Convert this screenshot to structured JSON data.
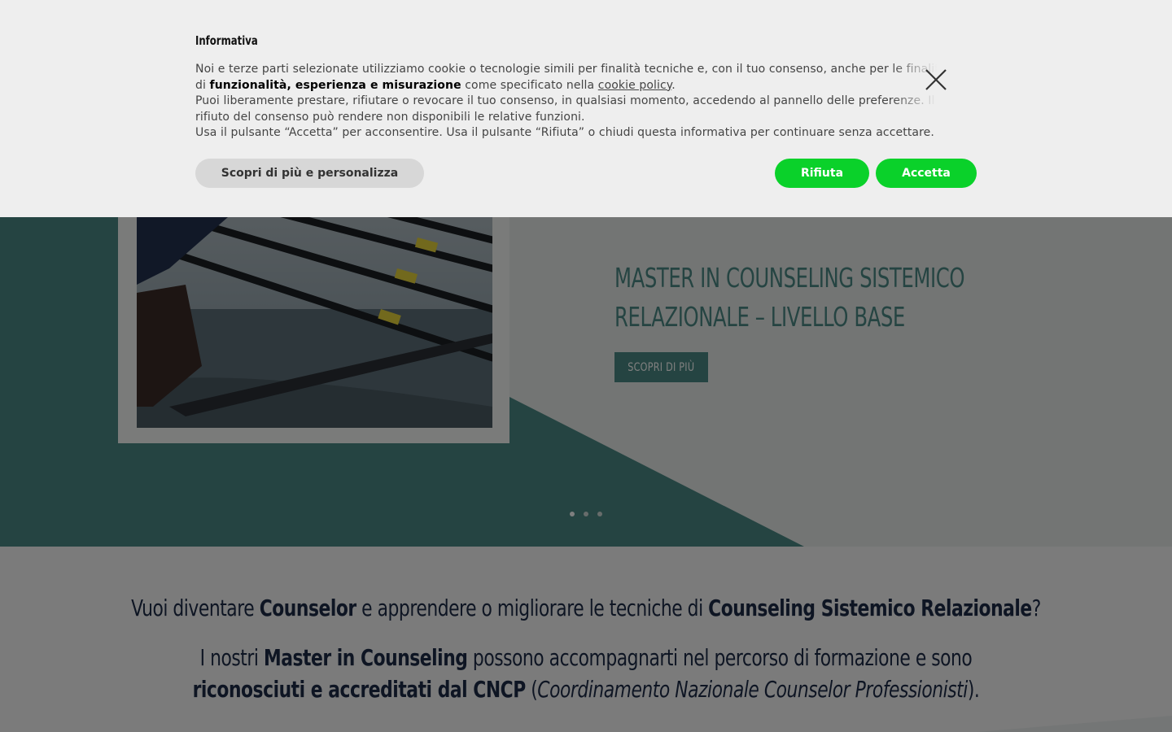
{
  "hero": {
    "title": "MASTER IN COUNSELING SISTEMICO RELAZIONALE – LIVELLO BASE",
    "cta_label": "SCOPRI DI PIÙ",
    "slides": [
      {
        "active": true
      },
      {
        "active": false
      },
      {
        "active": false
      }
    ]
  },
  "intro": {
    "q_pre": "Vuoi diventare ",
    "q_b1": "Counselor",
    "q_mid": " e apprendere o migliorare le tecniche di ",
    "q_b2": "Counseling Sistemico Relazionale",
    "q_end": "?",
    "p_pre": "I nostri ",
    "p_b1": "Master in Counseling",
    "p_mid": " possono accompagnarti nel percorso di formazione e sono ",
    "p_b2": "riconosciuti e accreditati dal CNCP",
    "p_open": " (",
    "p_italic": "Coordinamento Nazionale Counselor Professionisti",
    "p_close": ")."
  },
  "cookie_banner": {
    "title": "Informativa",
    "line1_pre": "Noi e terze parti selezionate utilizziamo cookie o tecnologie simili per finalità tecniche e, con il tuo consenso, anche per le finalità di ",
    "line1_bold": "funzionalità, esperienza e misurazione",
    "line1_mid": " come specificato nella ",
    "policy_link": "cookie policy",
    "line1_end": ".",
    "line2": "Puoi liberamente prestare, rifiutare o revocare il tuo consenso, in qualsiasi momento, accedendo al pannello delle preferenze. Il rifiuto del consenso può rendere non disponibili le relative funzioni.",
    "line3": "Usa il pulsante “Accetta” per acconsentire. Usa il pulsante “Rifiuta” o chiudi questa informativa per continuare senza accettare.",
    "more_label": "Scopri di più e personalizza",
    "reject_label": "Rifiuta",
    "accept_label": "Accetta",
    "accent_color": "#0ad12a"
  },
  "colors": {
    "brand_teal": "#4b8984",
    "navy_text": "#1c2a47"
  }
}
